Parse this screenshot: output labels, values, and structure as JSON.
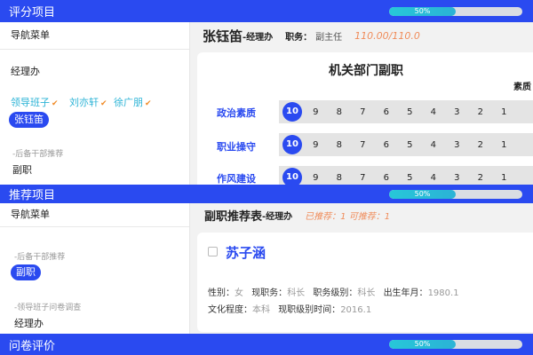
{
  "sections": [
    {
      "title": "评分项目",
      "progress_text": "50%",
      "progress": 0.5
    },
    {
      "title": "推荐项目",
      "progress_text": "50%",
      "progress": 0.5
    },
    {
      "title": "问卷评价",
      "progress_text": "50%",
      "progress": 0.5
    }
  ],
  "sidebar1": {
    "head": "导航菜单",
    "group": "经理办",
    "leaders": [
      "领导班子",
      "刘亦轩",
      "徐广朋"
    ],
    "selected": "张钰笛",
    "sub": "-后备干部推荐",
    "item": "副职"
  },
  "eval": {
    "name": "张钰笛",
    "dept": "-经理办",
    "pos_label": "职务：",
    "pos_value": "副主任",
    "score": "110.00/110.0",
    "card_title": "机关部门副职",
    "col_hint": "素质",
    "criteria": [
      {
        "label": "政治素质",
        "scores": [
          "10",
          "9",
          "8",
          "7",
          "6",
          "5",
          "4",
          "3",
          "2",
          "1"
        ],
        "selected": "10"
      },
      {
        "label": "职业操守",
        "scores": [
          "10",
          "9",
          "8",
          "7",
          "6",
          "5",
          "4",
          "3",
          "2",
          "1"
        ],
        "selected": "10"
      },
      {
        "label": "作风建设",
        "scores": [
          "10",
          "9",
          "8",
          "7",
          "6",
          "5",
          "4",
          "3",
          "2",
          "1"
        ],
        "selected": "10"
      }
    ]
  },
  "sidebar2": {
    "head": "导航菜单",
    "sub1": "-后备干部推荐",
    "selected": "副职",
    "sub2": "-领导班子问卷调查",
    "item": "经理办"
  },
  "rec": {
    "title": "副职推荐表",
    "dept": "-经理办",
    "status": "已推荐：1  可推荐：1",
    "candidate": "苏子涵",
    "gender_label": "性别：",
    "gender": "女",
    "pos_label": "现职务：",
    "pos": "科长",
    "level_label": "职务级别：",
    "level": "科长",
    "birth_label": "出生年月：",
    "birth": "1980.1",
    "edu_label": "文化程度：",
    "edu": "本科",
    "since_label": "现职级别时间：",
    "since": "2016.1"
  },
  "colors": {
    "accent": "#2a4af0",
    "progress": "#2bb3d6",
    "score": "#f08c5a"
  }
}
